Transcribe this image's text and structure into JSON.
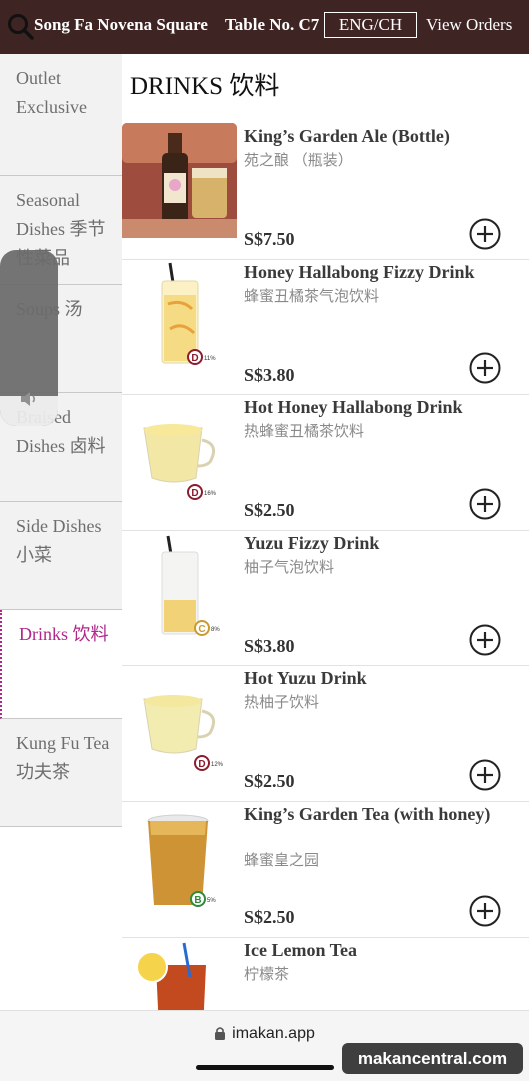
{
  "header": {
    "shop_name": "Song Fa Novena Square",
    "table_no": "Table No. C7",
    "language_button": "ENG/CH",
    "view_orders": "View Orders",
    "background_color": "#3f2424"
  },
  "sidebar": {
    "categories": [
      {
        "label": "Outlet Exclusive"
      },
      {
        "label": "Seasonal Dishes 季节性菜品"
      },
      {
        "label": "Soups 汤"
      },
      {
        "label": "Braised Dishes 卤料"
      },
      {
        "label": "Side Dishes 小菜"
      },
      {
        "label": "Drinks 饮料"
      },
      {
        "label": "Kung Fu Tea 功夫茶"
      }
    ],
    "active_index": 5,
    "active_color": "#b0268a"
  },
  "section": {
    "title": "DRINKS 饮料"
  },
  "items": [
    {
      "name": "King’s Garden Ale (Bottle)",
      "name_cn": "苑之酿 （瓶装）",
      "price": "S$7.50"
    },
    {
      "name": "Honey Hallabong Fizzy Drink",
      "name_cn": "蜂蜜丑橘茶气泡饮料",
      "price": "S$3.80",
      "nutri_grade": "D",
      "sugar": "11%"
    },
    {
      "name": "Hot Honey Hallabong Drink",
      "name_cn": "热蜂蜜丑橘茶饮料",
      "price": "S$2.50",
      "nutri_grade": "D",
      "sugar": "16%"
    },
    {
      "name": "Yuzu Fizzy Drink",
      "name_cn": "柚子气泡饮料",
      "price": "S$3.80",
      "nutri_grade": "C",
      "sugar": "8%"
    },
    {
      "name": "Hot Yuzu Drink",
      "name_cn": "热柚子饮料",
      "price": "S$2.50",
      "nutri_grade": "D",
      "sugar": "12%"
    },
    {
      "name": "King’s Garden Tea (with honey)",
      "name_cn": "蜂蜜皇之园",
      "price": "S$2.50",
      "nutri_grade": "B",
      "sugar": "5%"
    },
    {
      "name": "Ice Lemon Tea",
      "name_cn": "柠檬茶"
    }
  ],
  "browser": {
    "url": "imakan.app"
  },
  "watermark": "makancentral.com"
}
